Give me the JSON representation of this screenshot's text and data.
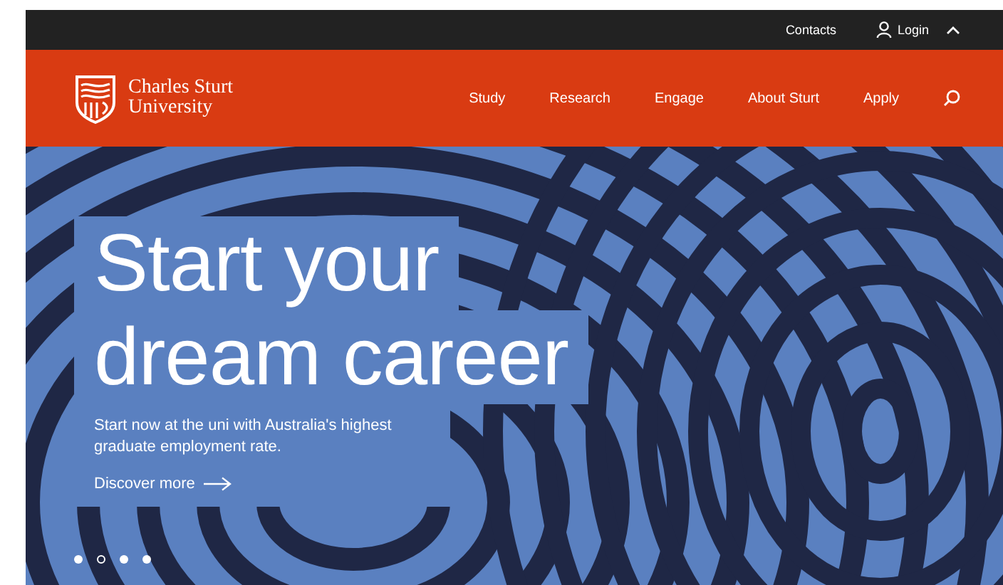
{
  "utility_bar": {
    "links": [
      "Contacts",
      "Login"
    ],
    "expanded": true
  },
  "header": {
    "logo_text": "Charles Sturt University",
    "nav": [
      {
        "label": "Study"
      },
      {
        "label": "Research"
      },
      {
        "label": "Engage"
      },
      {
        "label": "About Sturt"
      },
      {
        "label": "Apply"
      }
    ]
  },
  "hero": {
    "headline_lines": [
      "Start your",
      "dream career"
    ],
    "text": "Start now at the uni with Australia's highest graduate employment rate.",
    "link": "Discover more",
    "slides": [
      {
        "selected": false
      },
      {
        "selected": true
      },
      {
        "selected": false
      },
      {
        "selected": false
      }
    ]
  }
}
